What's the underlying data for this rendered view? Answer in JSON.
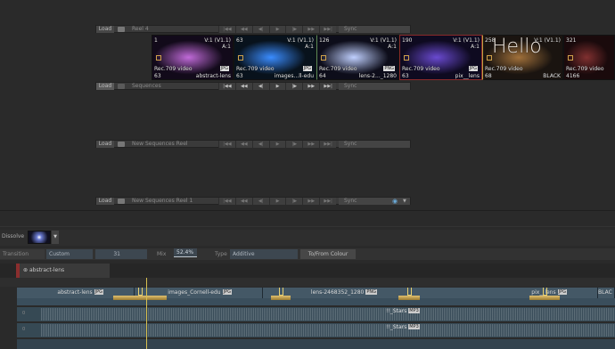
{
  "reels": [
    {
      "load": "Load",
      "name": "Reel 4",
      "sync": "Sync",
      "transport": [
        "|◀◀",
        "◀◀",
        "◀|",
        "▶",
        "|▶",
        "▶▶",
        "▶▶|"
      ]
    },
    {
      "load": "Load",
      "name": "Sequences",
      "sync": "Sync",
      "transport": [
        "|◀◀",
        "◀◀",
        "◀|",
        "▶",
        "|▶",
        "▶▶",
        "▶▶|"
      ]
    },
    {
      "load": "Load",
      "name": "New Sequences Reel",
      "sync": "Sync",
      "transport": [
        "|◀◀",
        "◀◀",
        "◀|",
        "▶",
        "|▶",
        "▶▶",
        "▶▶|"
      ]
    },
    {
      "load": "Load",
      "name": "New Sequences Reel 1",
      "sync": "Sync",
      "transport": [
        "|◀◀",
        "◀◀",
        "◀|",
        "▶",
        "|▶",
        "▶▶",
        "▶▶|"
      ]
    }
  ],
  "clips": [
    {
      "frame": "1",
      "version": "V:1 (V1.1)",
      "audio": "A:1",
      "format": "Rec.709 video",
      "count": "63",
      "name": "abstract-lens",
      "ext": "JPG",
      "bg": "#120a1a",
      "glow": "#c06ad8"
    },
    {
      "frame": "63",
      "version": "V:1 (V1.1)",
      "audio": "A:1",
      "format": "Rec.709 video",
      "count": "63",
      "name": "images...ll-edu",
      "ext": "JPG",
      "bg": "#08121c",
      "glow": "#3a8cff"
    },
    {
      "frame": "126",
      "version": "V:1 (V1.1)",
      "audio": "A:1",
      "format": "Rec.709 video",
      "count": "64",
      "name": "lens-2..._1280",
      "ext": "PNG",
      "bg": "#0d0d1a",
      "glow": "#c0d0ff"
    },
    {
      "frame": "190",
      "version": "V:1 (V1.1)",
      "audio": "A:1",
      "format": "Rec.709 video",
      "count": "63",
      "name": "pix__lens",
      "ext": "JPG",
      "bg": "#0e0a20",
      "glow": "#6a4ad0"
    },
    {
      "frame": "258",
      "version": "V:1 (V1.1)",
      "audio": "",
      "format": "Rec.709 video",
      "count": "68",
      "name": "BLACK",
      "ext": "",
      "bg": "#1a1410",
      "glow": "#a0703a",
      "big": "Hello"
    },
    {
      "frame": "321",
      "version": "",
      "audio": "",
      "format": "Rec.709 video",
      "count": "4166",
      "name": "",
      "ext": "",
      "bg": "#1a0a0c",
      "glow": "#803030"
    }
  ],
  "effect": {
    "label": "Dissolve"
  },
  "params": {
    "transition_label": "Transition",
    "transition_value": "Custom",
    "frames": "31",
    "mix_label": "Mix",
    "mix_value": "52.4%",
    "type_label": "Type",
    "type_value": "Additive",
    "to_from": "To/From Colour"
  },
  "tab": {
    "label": "abstract-lens"
  },
  "timeline": {
    "clips": [
      {
        "name": "abstract-lens",
        "ext": "JPG"
      },
      {
        "name": "images_Cornell-edu",
        "ext": "JPG"
      },
      {
        "name": "lens-2468352_1280",
        "ext": "PNG"
      },
      {
        "name": "pix__lens",
        "ext": "JPG"
      },
      {
        "name": "BLAC",
        "ext": ""
      }
    ],
    "audio": [
      {
        "name": "!!_Stars",
        "ext": "MP3"
      },
      {
        "name": "!!_Stars",
        "ext": "MP3"
      }
    ]
  },
  "colors": {
    "playhead": "#d8c050",
    "accent": "#e0c070",
    "track": "#3a4e5c"
  }
}
